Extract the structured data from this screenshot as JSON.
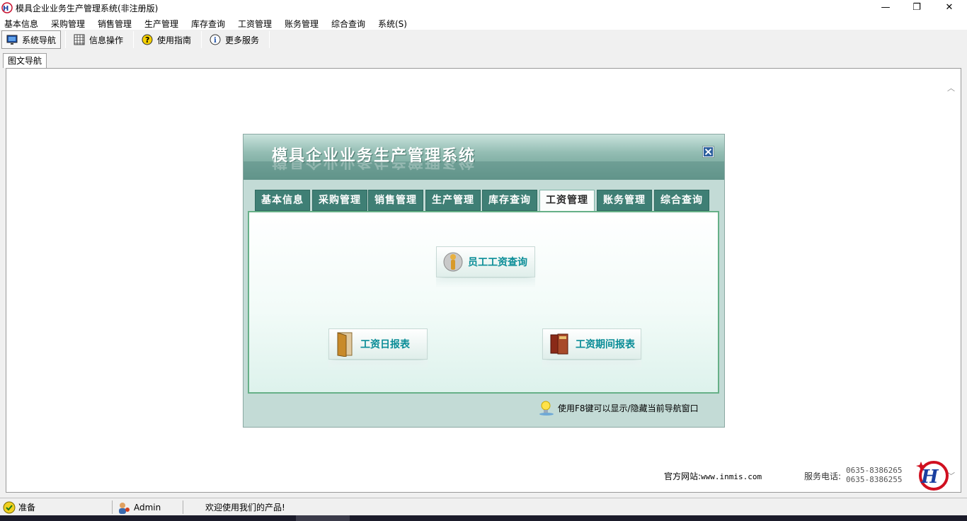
{
  "window": {
    "title": "模具企业业务生产管理系统(非注册版)",
    "min": "—",
    "max": "❐",
    "close": "✕"
  },
  "menu": [
    "基本信息",
    "采购管理",
    "销售管理",
    "生产管理",
    "库存查询",
    "工资管理",
    "账务管理",
    "综合查询",
    "系统(S)"
  ],
  "toolbar": {
    "nav": "系统导航",
    "info": "信息操作",
    "guide": "使用指南",
    "more": "更多服务"
  },
  "tabs": {
    "graphic_nav": "图文导航"
  },
  "dialog": {
    "title": "模具企业业务生产管理系统",
    "tabs": [
      "基本信息",
      "采购管理",
      "销售管理",
      "生产管理",
      "库存查询",
      "工资管理",
      "账务管理",
      "综合查询"
    ],
    "active_tab": "工资管理",
    "buttons": {
      "salary_query": "员工工资查询",
      "daily_report": "工资日报表",
      "period_report": "工资期间报表"
    },
    "hint": "使用F8键可以显示/隐藏当前导航窗口"
  },
  "footer": {
    "site_label": "官方网站:",
    "site_url": "www.inmis.com",
    "phone_label": "服务电话:",
    "phone1": "0635-8386265",
    "phone2": "0635-8386255"
  },
  "status": {
    "state": "准备",
    "user": "Admin",
    "welcome": "欢迎使用我们的产品!"
  },
  "colors": {
    "accent": "#3f7f75",
    "button_text": "#0a8d97",
    "panel_border": "#66b087"
  }
}
